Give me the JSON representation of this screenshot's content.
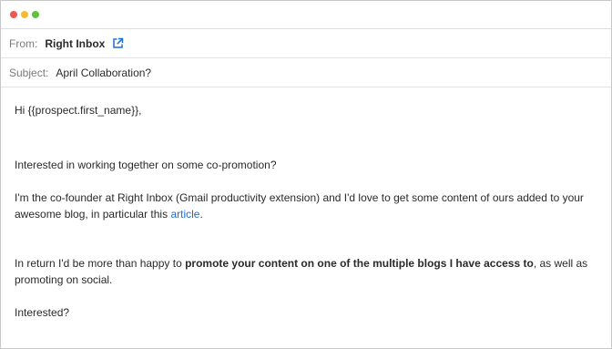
{
  "header": {
    "from_label": "From:",
    "from_name": "Right Inbox",
    "subject_label": "Subject:",
    "subject_value": "April Collaboration?"
  },
  "email": {
    "greeting": "Hi {{prospect.first_name}},",
    "line1": "Interested in working together on some co-promotion?",
    "para2_text": "I'm the co-founder at Right Inbox (Gmail productivity extension) and I'd love to get some content of ours added to your awesome blog, in particular this",
    "para2_link": "article",
    "para2_end": ".",
    "para3_start": "In return I'd be more than happy to",
    "para3_bold": "promote your content on one of the multiple blogs I have access to",
    "para3_end": ", as well as promoting on social.",
    "closing": "Interested?"
  },
  "icons": {
    "external_link": "external-link-icon"
  },
  "colors": {
    "accent": "#1a6fd6",
    "close": "#ee5a52",
    "minimize": "#f5bd2f",
    "zoom": "#5fc13e"
  }
}
